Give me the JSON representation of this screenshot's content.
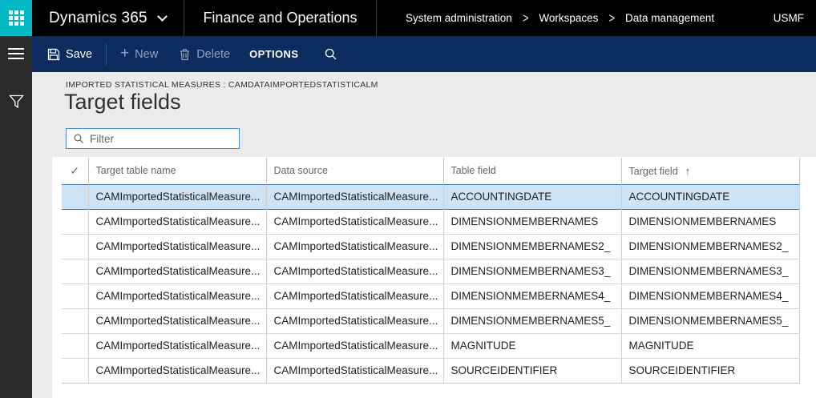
{
  "topbar": {
    "brand": "Dynamics 365",
    "app_name": "Finance and Operations",
    "breadcrumb": {
      "items": [
        "System administration",
        "Workspaces",
        "Data management"
      ],
      "separator": ">"
    },
    "company": "USMF"
  },
  "action_bar": {
    "save_label": "Save",
    "new_label": "New",
    "new_glyph": "+",
    "delete_label": "Delete",
    "options_label": "OPTIONS"
  },
  "page": {
    "caption": "IMPORTED STATISTICAL MEASURES : CAMDATAIMPORTEDSTATISTICALM",
    "title": "Target fields",
    "filter_placeholder": "Filter"
  },
  "grid": {
    "check_glyph": "✓",
    "sort_glyph": "↑",
    "sort_column": "Target field",
    "sort_direction": "ascending",
    "columns": [
      "Target table name",
      "Data source",
      "Table field",
      "Target field"
    ],
    "rows": [
      {
        "selected": true,
        "target_table_name": "CAMImportedStatisticalMeasure...",
        "data_source": "CAMImportedStatisticalMeasure...",
        "table_field": "ACCOUNTINGDATE",
        "target_field": "ACCOUNTINGDATE"
      },
      {
        "selected": false,
        "target_table_name": "CAMImportedStatisticalMeasure...",
        "data_source": "CAMImportedStatisticalMeasure...",
        "table_field": "DIMENSIONMEMBERNAMES",
        "target_field": "DIMENSIONMEMBERNAMES"
      },
      {
        "selected": false,
        "target_table_name": "CAMImportedStatisticalMeasure...",
        "data_source": "CAMImportedStatisticalMeasure...",
        "table_field": "DIMENSIONMEMBERNAMES2_",
        "target_field": "DIMENSIONMEMBERNAMES2_"
      },
      {
        "selected": false,
        "target_table_name": "CAMImportedStatisticalMeasure...",
        "data_source": "CAMImportedStatisticalMeasure...",
        "table_field": "DIMENSIONMEMBERNAMES3_",
        "target_field": "DIMENSIONMEMBERNAMES3_"
      },
      {
        "selected": false,
        "target_table_name": "CAMImportedStatisticalMeasure...",
        "data_source": "CAMImportedStatisticalMeasure...",
        "table_field": "DIMENSIONMEMBERNAMES4_",
        "target_field": "DIMENSIONMEMBERNAMES4_"
      },
      {
        "selected": false,
        "target_table_name": "CAMImportedStatisticalMeasure...",
        "data_source": "CAMImportedStatisticalMeasure...",
        "table_field": "DIMENSIONMEMBERNAMES5_",
        "target_field": "DIMENSIONMEMBERNAMES5_"
      },
      {
        "selected": false,
        "target_table_name": "CAMImportedStatisticalMeasure...",
        "data_source": "CAMImportedStatisticalMeasure...",
        "table_field": "MAGNITUDE",
        "target_field": "MAGNITUDE"
      },
      {
        "selected": false,
        "target_table_name": "CAMImportedStatisticalMeasure...",
        "data_source": "CAMImportedStatisticalMeasure...",
        "table_field": "SOURCEIDENTIFIER",
        "target_field": "SOURCEIDENTIFIER"
      }
    ]
  },
  "colors": {
    "accent_teal": "#00b7c3",
    "topbar_bg": "#000000",
    "actionbar_bg": "#0c2c5f",
    "sidebar_bg": "#2a2a2a",
    "content_bg": "#ebebeb",
    "selected_row_bg": "#cfe3f7",
    "selected_row_border": "#3c77b5",
    "filter_border": "#4a8ac9"
  }
}
